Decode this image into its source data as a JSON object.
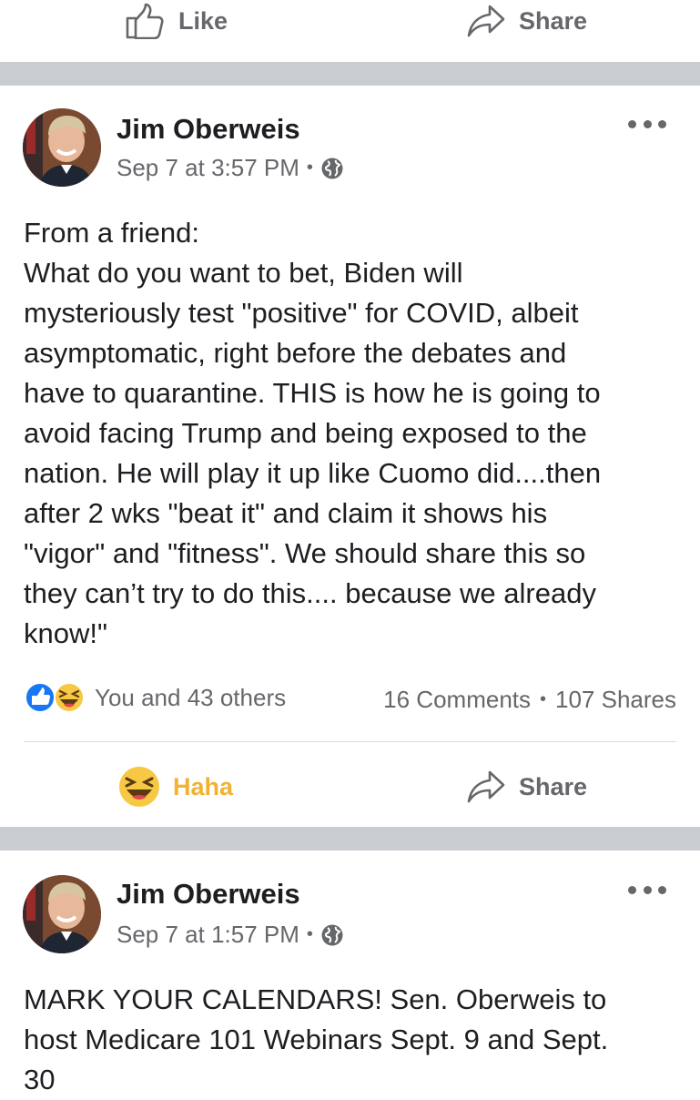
{
  "top_actions": {
    "like_label": "Like",
    "share_label": "Share"
  },
  "posts": [
    {
      "author": "Jim Oberweis",
      "timestamp": "Sep 7 at 3:57 PM",
      "audience_icon": "globe-icon",
      "text": "From a friend:\nWhat do you want to bet, Biden will\nmysteriously test \"positive\" for COVID, albeit\nasymptomatic, right before the debates and\nhave to quarantine. THIS is how he is going to\navoid facing Trump and being exposed to the\nnation. He will play it up like Cuomo did....then\nafter 2 wks \"beat it\" and claim it shows his\n\"vigor\" and \"fitness\". We should share this so\nthey can’t try to do this.... because we already\nknow!\"",
      "reactions_summary": "You and 43 others",
      "reaction_icons": [
        "like-icon",
        "haha-icon"
      ],
      "comments": "16 Comments",
      "shares": "107 Shares",
      "actions": {
        "reaction_label": "Haha",
        "share_label": "Share"
      }
    },
    {
      "author": "Jim Oberweis",
      "timestamp": "Sep 7 at 1:57 PM",
      "audience_icon": "globe-icon",
      "text": "MARK YOUR CALENDARS! Sen. Oberweis to\nhost Medicare 101 Webinars Sept. 9 and Sept.\n30"
    }
  ],
  "colors": {
    "separator": "#c9ccd1",
    "secondary_text": "#65676b",
    "haha": "#f2b130",
    "like_blue": "#1877f2"
  }
}
